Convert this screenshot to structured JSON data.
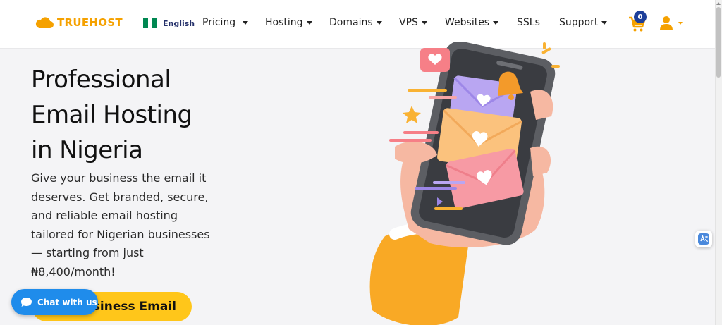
{
  "brand": {
    "name": "TRUEHOST",
    "accent": "#f5a100",
    "logo_icon": "cloud-icon"
  },
  "language": {
    "label": "English",
    "flag": "nigeria-flag-icon"
  },
  "nav": {
    "items": [
      {
        "label": "Pricing",
        "has_dropdown": true
      },
      {
        "label": "Hosting",
        "has_dropdown": true
      },
      {
        "label": "Domains",
        "has_dropdown": true
      },
      {
        "label": "VPS",
        "has_dropdown": true
      },
      {
        "label": "Websites",
        "has_dropdown": true
      },
      {
        "label": "SSLs",
        "has_dropdown": false
      },
      {
        "label": "Support",
        "has_dropdown": true
      }
    ]
  },
  "cart": {
    "count": "0",
    "icon": "cart-icon"
  },
  "account": {
    "icon": "user-icon"
  },
  "hero": {
    "title_lines": [
      "Professional",
      "Email Hosting",
      "in Nigeria"
    ],
    "description_lines": [
      "Give your business the email it",
      "deserves. Get branded, secure,",
      "and reliable email hosting",
      "tailored for Nigerian businesses",
      "— starting from just",
      "₦8,400/month!"
    ],
    "cta_label": "Get Business Email",
    "cta_visible_label": "siness Email"
  },
  "chat": {
    "label": "Chat with us",
    "icon": "chat-bubble-icon"
  },
  "translate": {
    "icon": "translate-icon"
  },
  "colors": {
    "cta": "#ffc61a",
    "chat": "#1f8ceb",
    "badge": "#1d3f9a",
    "flag_green": "#008751"
  }
}
